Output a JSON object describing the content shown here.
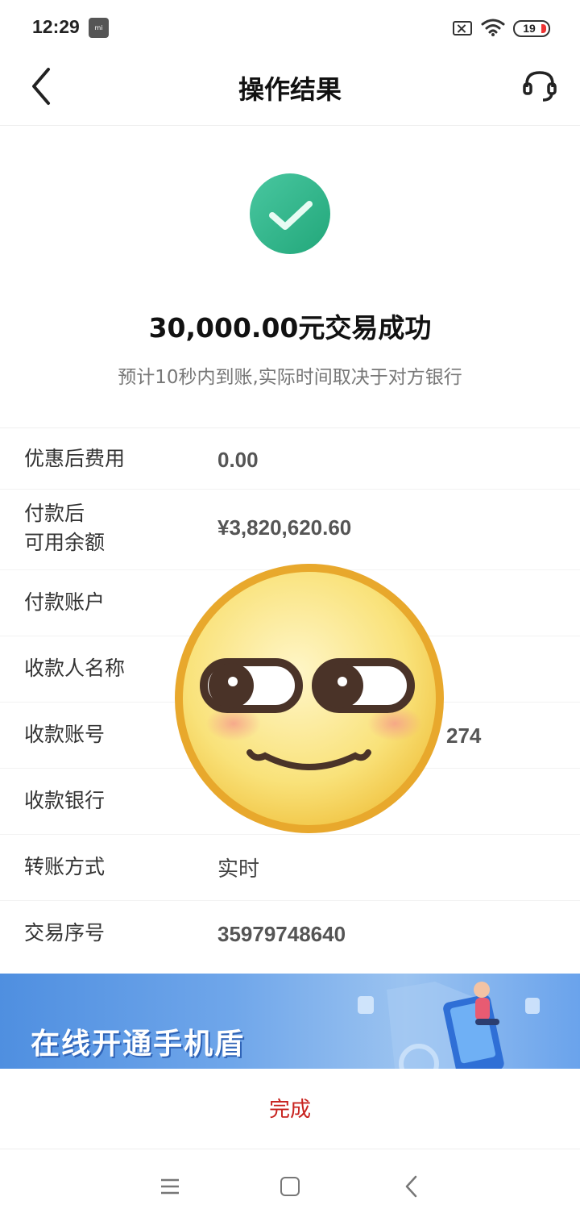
{
  "status_bar": {
    "time": "12:29",
    "battery": "19"
  },
  "header": {
    "title": "操作结果",
    "back_icon": "chevron-left-icon",
    "service_icon": "headset-icon"
  },
  "result": {
    "status_icon": "check-circle-icon",
    "headline": "30,000.00元交易成功",
    "subtitle": "预计10秒内到账,实际时间取决于对方银行"
  },
  "details": {
    "fee_label": "优惠后费用",
    "fee_value": "0.00",
    "balance_label_line1": "付款后",
    "balance_label_line2": "可用余额",
    "balance_value": "¥3,820,620.60",
    "payer_account_label": "付款账户",
    "payee_name_label": "收款人名称",
    "payee_account_label": "收款账号",
    "payee_account_value_visible": "274",
    "payee_bank_label": "收款银行",
    "transfer_method_label": "转账方式",
    "transfer_method_value": "实时",
    "serial_label": "交易序号",
    "serial_value": "35979748640"
  },
  "overlay": {
    "icon": "smiling-face-sticker-icon"
  },
  "banner": {
    "text": "在线开通手机盾"
  },
  "actions": {
    "done_label": "完成"
  },
  "colors": {
    "accent_red": "#c8231f",
    "success_green": "#2db38a",
    "banner_blue": "#5b97e4"
  }
}
